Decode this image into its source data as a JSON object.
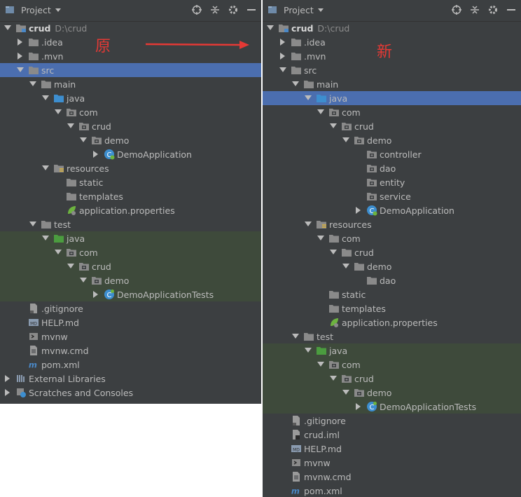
{
  "header": {
    "title": "Project"
  },
  "annotations": {
    "left_label": "原",
    "right_label": "新",
    "arrow_color": "#e53935"
  },
  "colors": {
    "panel_bg": "#3c3f41",
    "selection": "#4b6eaf",
    "test_bg": "#3e4a3b",
    "folder": "#8a8a8a",
    "source_folder": "#3d8ecf",
    "test_folder": "#4b9c3f"
  },
  "left_tree": [
    {
      "depth": 0,
      "arrow": "down",
      "icon": "module-folder",
      "label": "crud",
      "bold": true,
      "path": "D:\\crud"
    },
    {
      "depth": 1,
      "arrow": "right",
      "icon": "folder",
      "label": ".idea"
    },
    {
      "depth": 1,
      "arrow": "right",
      "icon": "folder",
      "label": ".mvn"
    },
    {
      "depth": 1,
      "arrow": "down",
      "icon": "folder",
      "label": "src",
      "selected": true
    },
    {
      "depth": 2,
      "arrow": "down",
      "icon": "folder",
      "label": "main"
    },
    {
      "depth": 3,
      "arrow": "down",
      "icon": "source-folder",
      "label": "java"
    },
    {
      "depth": 4,
      "arrow": "down",
      "icon": "package",
      "label": "com"
    },
    {
      "depth": 5,
      "arrow": "down",
      "icon": "package",
      "label": "crud"
    },
    {
      "depth": 6,
      "arrow": "down",
      "icon": "package",
      "label": "demo"
    },
    {
      "depth": 7,
      "arrow": "right",
      "icon": "spring-class",
      "label": "DemoApplication"
    },
    {
      "depth": 3,
      "arrow": "down",
      "icon": "resources-folder",
      "label": "resources"
    },
    {
      "depth": 4,
      "arrow": "none",
      "icon": "folder",
      "label": "static"
    },
    {
      "depth": 4,
      "arrow": "none",
      "icon": "folder",
      "label": "templates"
    },
    {
      "depth": 4,
      "arrow": "none",
      "icon": "properties",
      "label": "application.properties"
    },
    {
      "depth": 2,
      "arrow": "down",
      "icon": "folder",
      "label": "test"
    },
    {
      "depth": 3,
      "arrow": "down",
      "icon": "test-folder",
      "label": "java",
      "test": true
    },
    {
      "depth": 4,
      "arrow": "down",
      "icon": "package",
      "label": "com",
      "test": true
    },
    {
      "depth": 5,
      "arrow": "down",
      "icon": "package",
      "label": "crud",
      "test": true
    },
    {
      "depth": 6,
      "arrow": "down",
      "icon": "package",
      "label": "demo",
      "test": true
    },
    {
      "depth": 7,
      "arrow": "right",
      "icon": "test-class",
      "label": "DemoApplicationTests",
      "test": true
    },
    {
      "depth": 1,
      "arrow": "none",
      "icon": "gitignore",
      "label": ".gitignore"
    },
    {
      "depth": 1,
      "arrow": "none",
      "icon": "markdown",
      "label": "HELP.md"
    },
    {
      "depth": 1,
      "arrow": "none",
      "icon": "terminal",
      "label": "mvnw"
    },
    {
      "depth": 1,
      "arrow": "none",
      "icon": "file",
      "label": "mvnw.cmd"
    },
    {
      "depth": 1,
      "arrow": "none",
      "icon": "maven",
      "label": "pom.xml"
    },
    {
      "depth": 0,
      "arrow": "right",
      "icon": "libraries",
      "label": "External Libraries"
    },
    {
      "depth": 0,
      "arrow": "right",
      "icon": "scratches",
      "label": "Scratches and Consoles"
    }
  ],
  "right_tree": [
    {
      "depth": 0,
      "arrow": "down",
      "icon": "module-folder",
      "label": "crud",
      "bold": true,
      "path": "D:\\crud"
    },
    {
      "depth": 1,
      "arrow": "right",
      "icon": "folder",
      "label": ".idea"
    },
    {
      "depth": 1,
      "arrow": "right",
      "icon": "folder",
      "label": ".mvn"
    },
    {
      "depth": 1,
      "arrow": "down",
      "icon": "folder",
      "label": "src"
    },
    {
      "depth": 2,
      "arrow": "down",
      "icon": "folder",
      "label": "main"
    },
    {
      "depth": 3,
      "arrow": "down",
      "icon": "source-folder",
      "label": "java",
      "selected": true
    },
    {
      "depth": 4,
      "arrow": "down",
      "icon": "package",
      "label": "com"
    },
    {
      "depth": 5,
      "arrow": "down",
      "icon": "package",
      "label": "crud"
    },
    {
      "depth": 6,
      "arrow": "down",
      "icon": "package",
      "label": "demo"
    },
    {
      "depth": 7,
      "arrow": "none",
      "icon": "package",
      "label": "controller"
    },
    {
      "depth": 7,
      "arrow": "none",
      "icon": "package",
      "label": "dao"
    },
    {
      "depth": 7,
      "arrow": "none",
      "icon": "package",
      "label": "entity"
    },
    {
      "depth": 7,
      "arrow": "none",
      "icon": "package",
      "label": "service"
    },
    {
      "depth": 7,
      "arrow": "right",
      "icon": "spring-class",
      "label": "DemoApplication"
    },
    {
      "depth": 3,
      "arrow": "down",
      "icon": "resources-folder",
      "label": "resources"
    },
    {
      "depth": 4,
      "arrow": "down",
      "icon": "folder",
      "label": "com"
    },
    {
      "depth": 5,
      "arrow": "down",
      "icon": "folder",
      "label": "crud"
    },
    {
      "depth": 6,
      "arrow": "down",
      "icon": "folder",
      "label": "demo"
    },
    {
      "depth": 7,
      "arrow": "none",
      "icon": "folder",
      "label": "dao"
    },
    {
      "depth": 4,
      "arrow": "none",
      "icon": "folder",
      "label": "static"
    },
    {
      "depth": 4,
      "arrow": "none",
      "icon": "folder",
      "label": "templates"
    },
    {
      "depth": 4,
      "arrow": "none",
      "icon": "properties",
      "label": "application.properties"
    },
    {
      "depth": 2,
      "arrow": "down",
      "icon": "folder",
      "label": "test"
    },
    {
      "depth": 3,
      "arrow": "down",
      "icon": "test-folder",
      "label": "java",
      "test": true
    },
    {
      "depth": 4,
      "arrow": "down",
      "icon": "package",
      "label": "com",
      "test": true
    },
    {
      "depth": 5,
      "arrow": "down",
      "icon": "package",
      "label": "crud",
      "test": true
    },
    {
      "depth": 6,
      "arrow": "down",
      "icon": "package",
      "label": "demo",
      "test": true
    },
    {
      "depth": 7,
      "arrow": "right",
      "icon": "test-class",
      "label": "DemoApplicationTests",
      "test": true
    },
    {
      "depth": 1,
      "arrow": "none",
      "icon": "gitignore",
      "label": ".gitignore"
    },
    {
      "depth": 1,
      "arrow": "none",
      "icon": "iml",
      "label": "crud.iml"
    },
    {
      "depth": 1,
      "arrow": "none",
      "icon": "markdown",
      "label": "HELP.md"
    },
    {
      "depth": 1,
      "arrow": "none",
      "icon": "terminal",
      "label": "mvnw"
    },
    {
      "depth": 1,
      "arrow": "none",
      "icon": "file",
      "label": "mvnw.cmd"
    },
    {
      "depth": 1,
      "arrow": "none",
      "icon": "maven",
      "label": "pom.xml"
    }
  ]
}
